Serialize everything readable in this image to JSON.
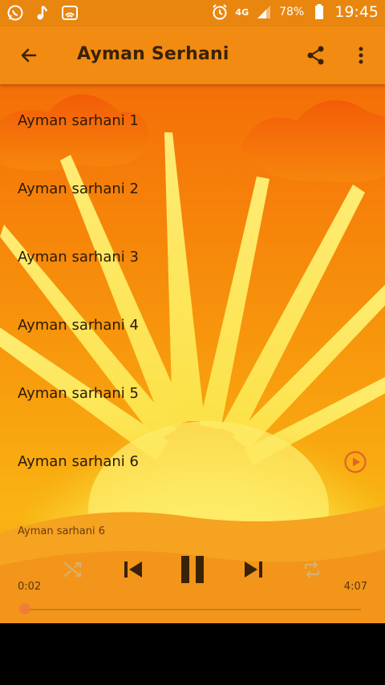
{
  "status_bar": {
    "time": "19:45",
    "battery": "78%",
    "network": "4G",
    "icons": [
      "whatsapp-icon",
      "music-note-icon",
      "cast-icon",
      "alarm-icon",
      "signal-icon",
      "battery-icon"
    ]
  },
  "app_bar": {
    "title": "Ayman Serhani",
    "icons": [
      "back-arrow-icon",
      "share-icon",
      "more-vert-icon"
    ]
  },
  "tracks": [
    {
      "label": "Ayman sarhani 1"
    },
    {
      "label": "Ayman sarhani 2"
    },
    {
      "label": "Ayman sarhani 3"
    },
    {
      "label": "Ayman sarhani 4"
    },
    {
      "label": "Ayman sarhani 5"
    },
    {
      "label": "Ayman sarhani 6",
      "playing": true
    }
  ],
  "player": {
    "now_playing": "Ayman sarhani 6",
    "elapsed": "0:02",
    "duration": "4:07",
    "progress_fraction": 0.008,
    "controls": [
      "shuffle-icon",
      "previous-icon",
      "pause-icon",
      "next-icon",
      "repeat-icon"
    ]
  },
  "colors": {
    "status_bar": "#e9860f",
    "app_bar": "#f28b12",
    "title_text": "#3a2208",
    "accent": "#e0632a"
  }
}
